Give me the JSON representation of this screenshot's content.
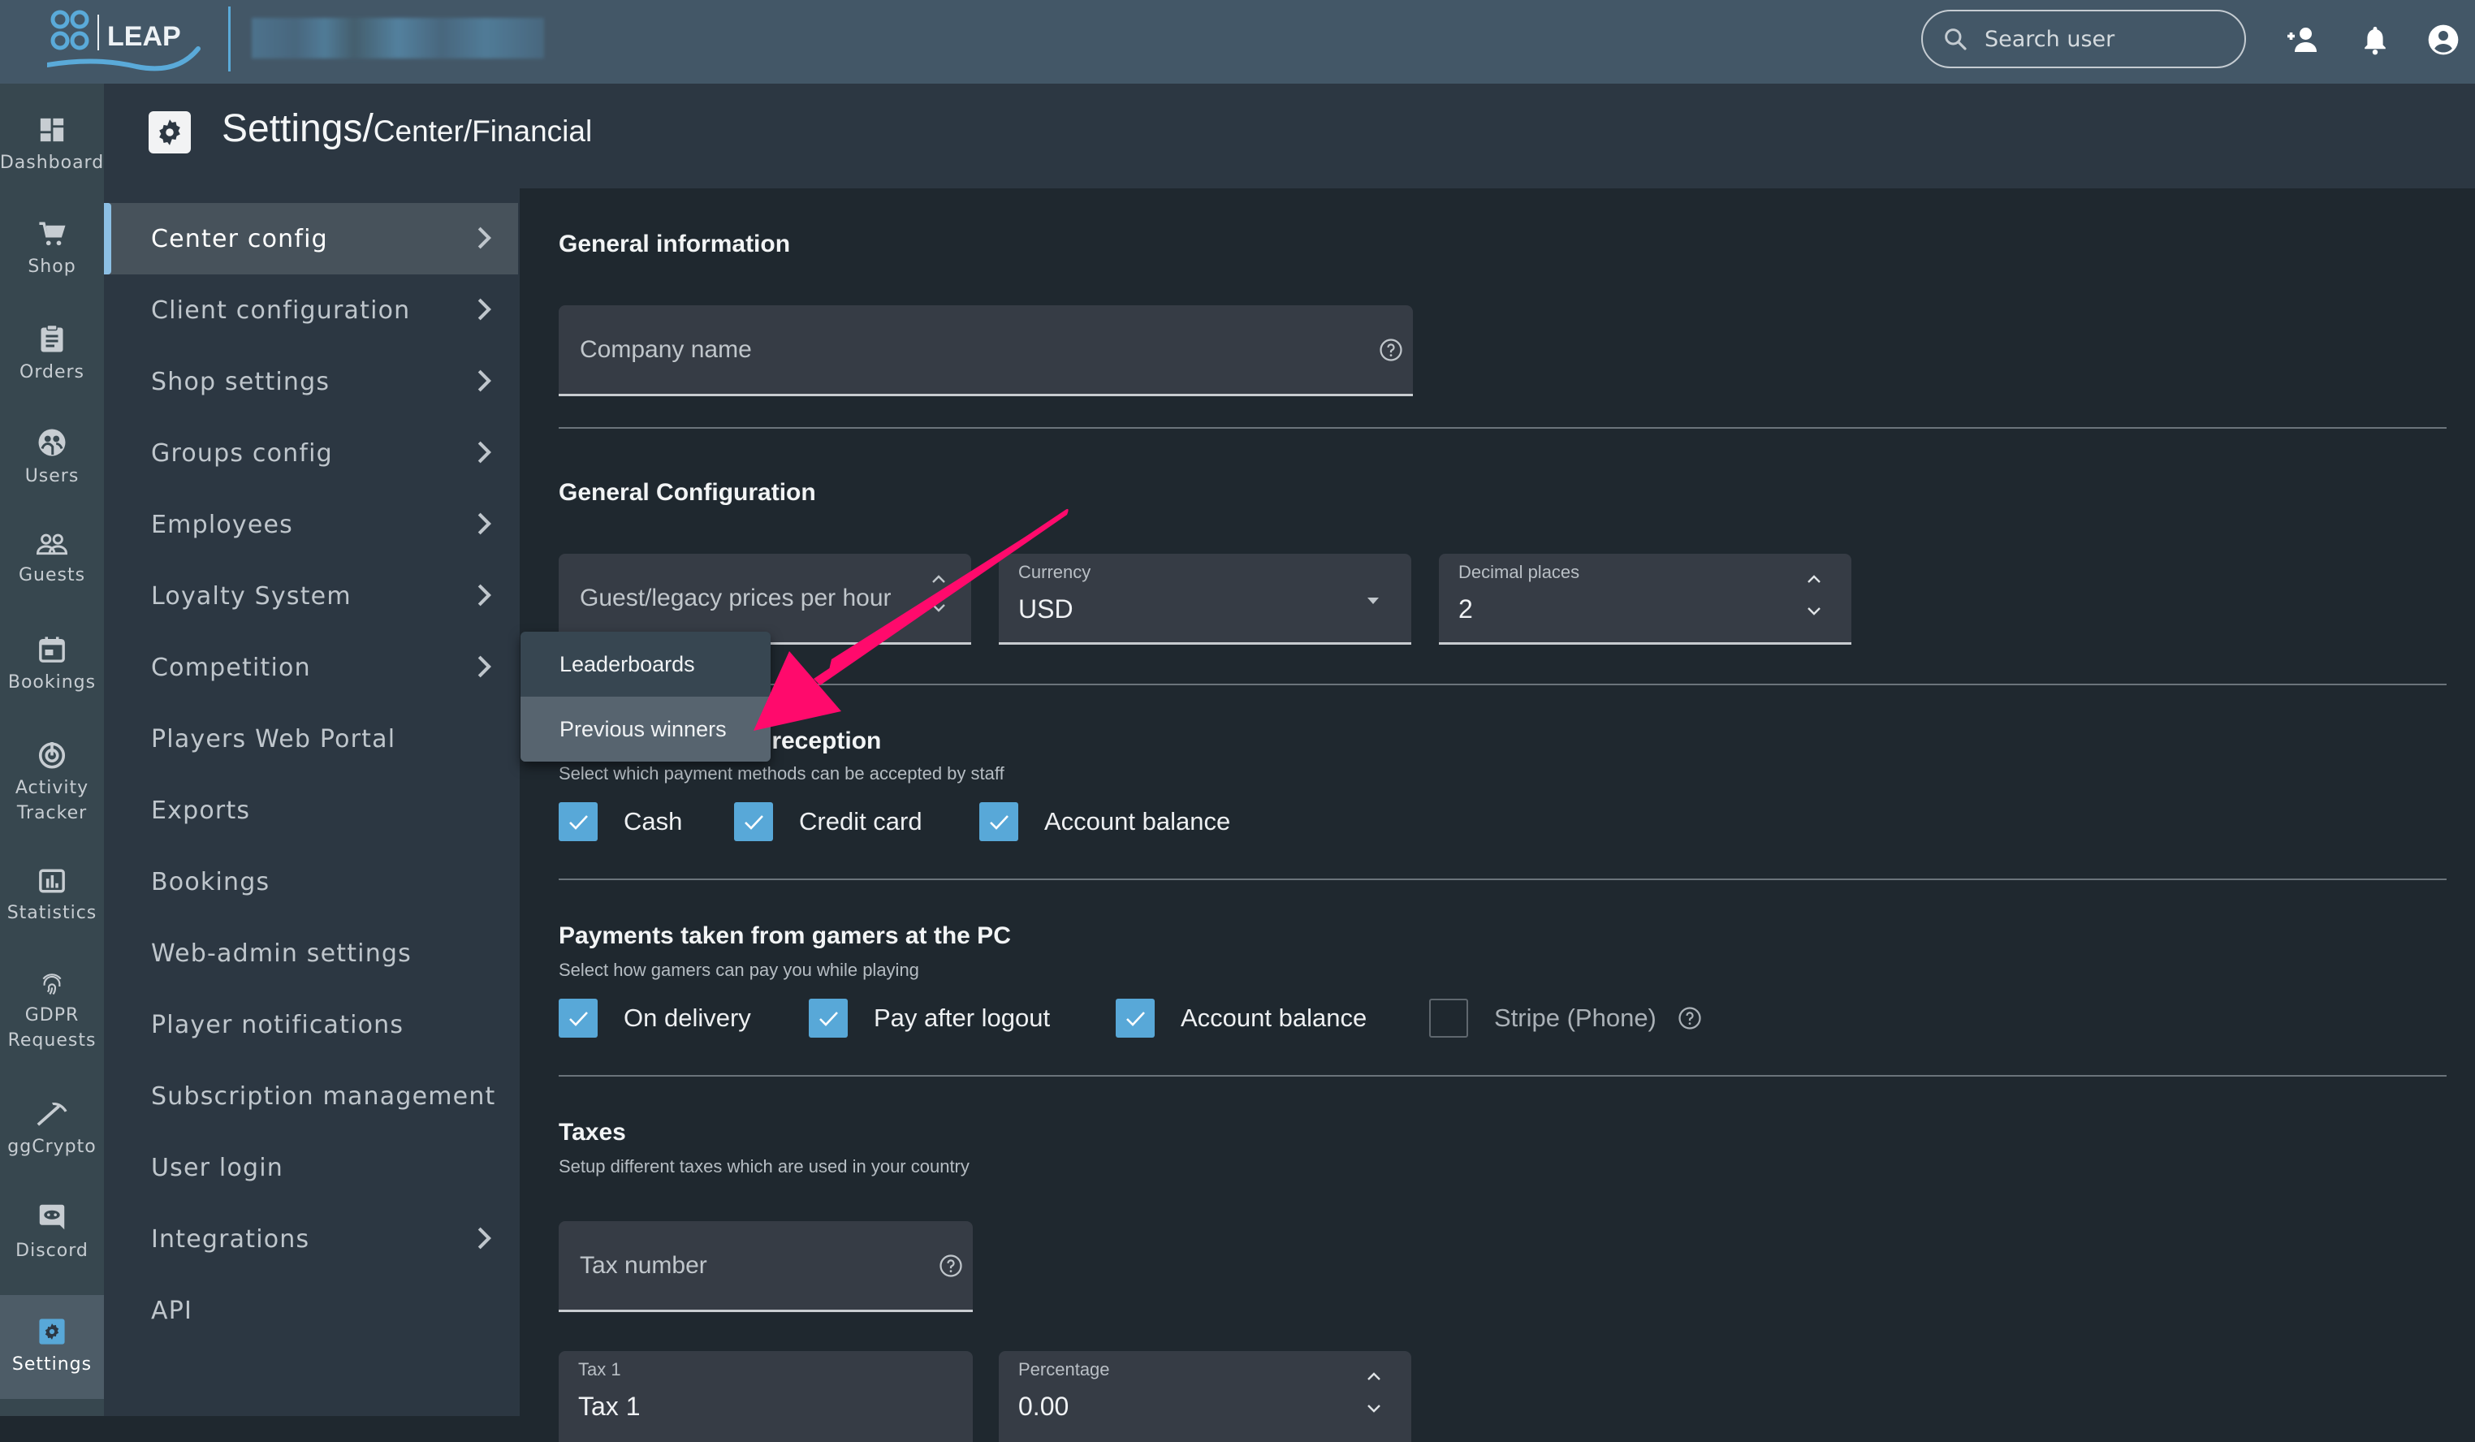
{
  "topbar": {
    "logo_text": "LEAP",
    "search_placeholder": "Search user",
    "icons": [
      "add-user-icon",
      "bell-icon",
      "account-icon"
    ]
  },
  "rail": {
    "items": [
      {
        "label": "Dashboard",
        "icon": "dashboard-icon"
      },
      {
        "label": "Shop",
        "icon": "cart-icon"
      },
      {
        "label": "Orders",
        "icon": "clipboard-icon"
      },
      {
        "label": "Users",
        "icon": "users-icon"
      },
      {
        "label": "Guests",
        "icon": "guests-icon"
      },
      {
        "label": "Bookings",
        "icon": "calendar-icon"
      },
      {
        "label": "Activity Tracker",
        "icon": "activity-icon"
      },
      {
        "label": "Statistics",
        "icon": "chart-icon"
      },
      {
        "label": "GDPR Requests",
        "icon": "fingerprint-icon"
      },
      {
        "label": "ggCrypto",
        "icon": "pickaxe-icon"
      },
      {
        "label": "Discord",
        "icon": "discord-icon"
      },
      {
        "label": "Settings",
        "icon": "settings-icon",
        "active": true
      }
    ]
  },
  "header": {
    "title_main": "Settings/",
    "title_sub": "Center/Financial"
  },
  "submenu": {
    "items": [
      {
        "label": "Center config",
        "chevron": true,
        "active": true
      },
      {
        "label": "Client configuration",
        "chevron": true
      },
      {
        "label": "Shop settings",
        "chevron": true
      },
      {
        "label": "Groups config",
        "chevron": true
      },
      {
        "label": "Employees",
        "chevron": true
      },
      {
        "label": "Loyalty System",
        "chevron": true
      },
      {
        "label": "Competition",
        "chevron": true
      },
      {
        "label": "Players Web Portal",
        "chevron": false
      },
      {
        "label": "Exports",
        "chevron": false
      },
      {
        "label": "Bookings",
        "chevron": false
      },
      {
        "label": "Web-admin settings",
        "chevron": false
      },
      {
        "label": "Player notifications",
        "chevron": false
      },
      {
        "label": "Subscription management",
        "chevron": false
      },
      {
        "label": "User login",
        "chevron": false
      },
      {
        "label": "Integrations",
        "chevron": true
      },
      {
        "label": "API",
        "chevron": false
      }
    ]
  },
  "popup": {
    "items": [
      "Leaderboards",
      "Previous winners"
    ],
    "hovered": "Previous winners"
  },
  "content": {
    "general_info": {
      "title": "General information",
      "company_name_placeholder": "Company name"
    },
    "general_config": {
      "title": "General Configuration",
      "guest_prices_placeholder": "Guest/legacy prices per hour",
      "currency_label": "Currency",
      "currency_value": "USD",
      "decimal_label": "Decimal places",
      "decimal_value": "2"
    },
    "reception": {
      "title_visible": "t reception",
      "subtitle": "Select which payment methods can be accepted by staff",
      "options": [
        {
          "label": "Cash",
          "checked": true
        },
        {
          "label": "Credit card",
          "checked": true
        },
        {
          "label": "Account balance",
          "checked": true
        }
      ]
    },
    "pc_payments": {
      "title": "Payments taken from gamers at the PC",
      "subtitle": "Select how gamers can pay you while playing",
      "options": [
        {
          "label": "On delivery",
          "checked": true
        },
        {
          "label": "Pay after logout",
          "checked": true
        },
        {
          "label": "Account balance",
          "checked": true
        },
        {
          "label": "Stripe (Phone)",
          "checked": false
        }
      ]
    },
    "taxes": {
      "title": "Taxes",
      "subtitle": "Setup different taxes which are used in your country",
      "tax_number_placeholder": "Tax number",
      "tax1_label": "Tax 1",
      "tax1_value": "Tax 1",
      "percentage_label": "Percentage",
      "percentage_value": "0.00"
    }
  },
  "colors": {
    "accent": "#58a8d8",
    "annotation_arrow": "#ff0a6c",
    "topbar": "#435767",
    "background": "#1f282f"
  }
}
